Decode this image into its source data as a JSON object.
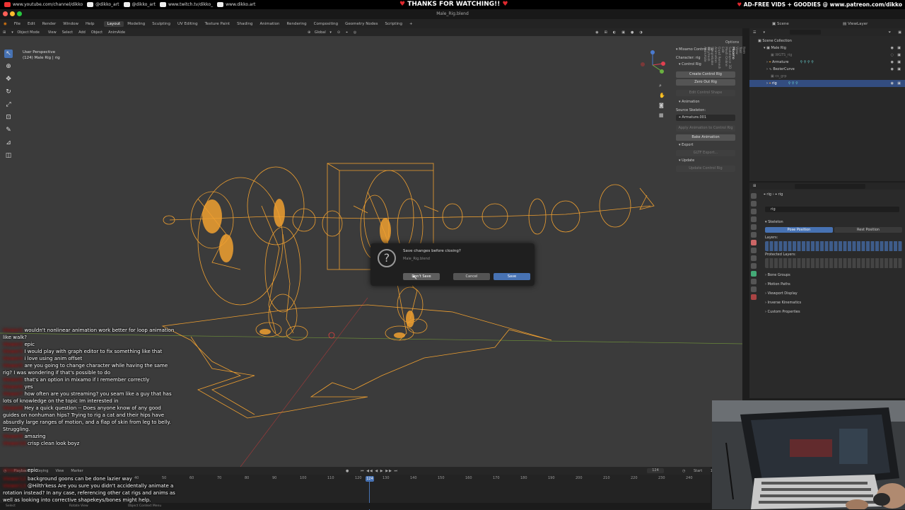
{
  "stream_bar": {
    "links": [
      {
        "icon": "youtube-icon",
        "label": "www.youtube.com/channel/dikko"
      },
      {
        "icon": "instagram-icon",
        "label": "@dikko_art"
      },
      {
        "icon": "twitter-icon",
        "label": "@dikko_art"
      },
      {
        "icon": "twitch-icon",
        "label": "www.twitch.tv/dikko_"
      },
      {
        "icon": "web-icon",
        "label": "www.dikko.art"
      }
    ],
    "center": "THANKS FOR WATCHING!!",
    "right": "AD-FREE VIDS + GOODIES @ www.patreon.com/dikko"
  },
  "window": {
    "title": "Male_Rig.blend"
  },
  "topbar": {
    "menus": [
      "File",
      "Edit",
      "Render",
      "Window",
      "Help"
    ],
    "workspaces": [
      "Layout",
      "Modeling",
      "Sculpting",
      "UV Editing",
      "Texture Paint",
      "Shading",
      "Animation",
      "Rendering",
      "Compositing",
      "Geometry Nodes",
      "Scripting"
    ],
    "active_workspace": "Layout",
    "scene": "Scene",
    "view_layer": "ViewLayer"
  },
  "viewport_header": {
    "mode": "Object Mode",
    "menus": [
      "View",
      "Select",
      "Add",
      "Object",
      "AnimAide"
    ],
    "orientation": "Global",
    "options": "Options"
  },
  "viewport_info": {
    "view": "User Perspective",
    "object": "(124) Male Rig | rig"
  },
  "npanel": {
    "panel_title": "Mixamo Control Rig",
    "character_label": "Character: rig",
    "control_rig_header": "Control Rig",
    "create_btn": "Create Control Rig",
    "zero_btn": "Zero Out Rig",
    "edit_shape_btn": "Edit Control Shape",
    "animation_header": "Animation",
    "source_label": "Source Skeleton:",
    "source_value": "Armature.001",
    "apply_btn": "Apply Animation to Control Rig",
    "bake_btn": "Bake Animation",
    "export_header": "Export",
    "gltf_btn": "GLTF Export...",
    "update_header": "Update",
    "update_btn": "Update Control Rig",
    "tabs": [
      "Item",
      "Tool",
      "View",
      "Mixamo",
      "Substance 3D",
      "Mesh Online",
      "Edit",
      "Quad Remesh",
      "Animation",
      "Simplebake",
      "Polyfresh",
      "AnimAide"
    ],
    "active_tab": "Mixamo"
  },
  "dialog": {
    "title": "Save changes before closing?",
    "file": "Male_Rig.blend",
    "dont_save": "Don't Save",
    "cancel": "Cancel",
    "save": "Save"
  },
  "outliner": {
    "root": "Scene Collection",
    "items": [
      {
        "label": "Male Rig",
        "indent": 1
      },
      {
        "label": "WGTS_rig",
        "indent": 2
      },
      {
        "label": "Armature",
        "indent": 2
      },
      {
        "label": "BezierCurve",
        "indent": 2
      },
      {
        "label": "cs_grp",
        "indent": 2
      },
      {
        "label": "rig",
        "indent": 2
      }
    ],
    "selected_index": 5
  },
  "properties": {
    "breadcrumb_a": "rig",
    "breadcrumb_b": "rig",
    "name_field": "rig",
    "skeleton_header": "Skeleton",
    "pose_position": "Pose Position",
    "rest_position": "Rest Position",
    "layers_label": "Layers:",
    "protected_label": "Protected Layers:",
    "sections": [
      "Bone Groups",
      "Motion Paths",
      "Viewport Display",
      "Inverse Kinematics",
      "Custom Properties"
    ]
  },
  "chat": [
    {
      "user": "Viewer1",
      "text": "wouldn't nonlinear animation work better for loop animation like walk?"
    },
    {
      "user": "Viewer2",
      "text": "epic"
    },
    {
      "user": "Viewer3",
      "text": "I would play with graph editor to fix something like that"
    },
    {
      "user": "Viewer4",
      "text": "i love using anim offset"
    },
    {
      "user": "Viewer5",
      "text": "are you going to change character while having the same rig? I was wondering if that's possible to do"
    },
    {
      "user": "Viewer5",
      "text": "that's an option in mixamo if I remember correctly"
    },
    {
      "user": "Viewer6",
      "text": "yes"
    },
    {
      "user": "Viewer7",
      "text": "how often are you streaming? you seam like a guy that has lots of knowledge on the topic Im interested in"
    },
    {
      "user": "Viewer8",
      "text": "Hey a quick question -- Does anyone know of any good guides on nonhuman hips? Trying to rig a cat and their hips have absurdly large ranges of motion, and a flap of skin from leg to belly. Struggling."
    },
    {
      "user": "Viewer9",
      "text": "amazing"
    },
    {
      "user": "Viewer10",
      "text": "crisp clean look boyz"
    },
    {
      "user": "Viewer11",
      "text": "epic"
    },
    {
      "user": "Viewer12",
      "text": "background goons can be done lazier way"
    },
    {
      "user": "Viewer13",
      "text": "@Hilth'kess Are you sure you didn't accidentally animate a rotation instead? In any case, referencing other cat rigs and anims as well as looking into corrective shapekeys/bones might help."
    }
  ],
  "timeline": {
    "menus": [
      "Playback",
      "Keying",
      "View",
      "Marker"
    ],
    "current_frame": "124",
    "start_label": "Start",
    "start_value": "1",
    "ticks": [
      "40",
      "50",
      "60",
      "70",
      "80",
      "90",
      "100",
      "110",
      "120",
      "130",
      "140",
      "150",
      "160",
      "170",
      "180",
      "190",
      "200",
      "210",
      "220",
      "230",
      "240"
    ],
    "cursor": "124"
  },
  "status": [
    "Select",
    "Rotate View",
    "Object Context Menu"
  ],
  "colors": {
    "accent": "#4772b3",
    "rig": "#f0a030",
    "viewport_bg": "#3b3b3b",
    "chat_user": "#e02020"
  }
}
